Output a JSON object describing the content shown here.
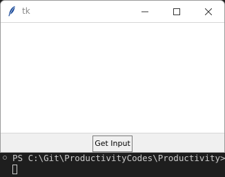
{
  "window": {
    "title": "tk",
    "icon": "feather-icon",
    "controls": [
      "minimize-icon",
      "maximize-icon",
      "close-icon"
    ]
  },
  "main": {
    "button_label": "Get Input"
  },
  "terminal": {
    "prompt_line": "PS C:\\Git\\ProductivityCodes\\Productivity> &"
  },
  "colors": {
    "terminal_bg": "#1e1e1e",
    "terminal_text": "#cccccc",
    "window_bg": "#f0f0f0",
    "client_bg": "#ffffff"
  }
}
